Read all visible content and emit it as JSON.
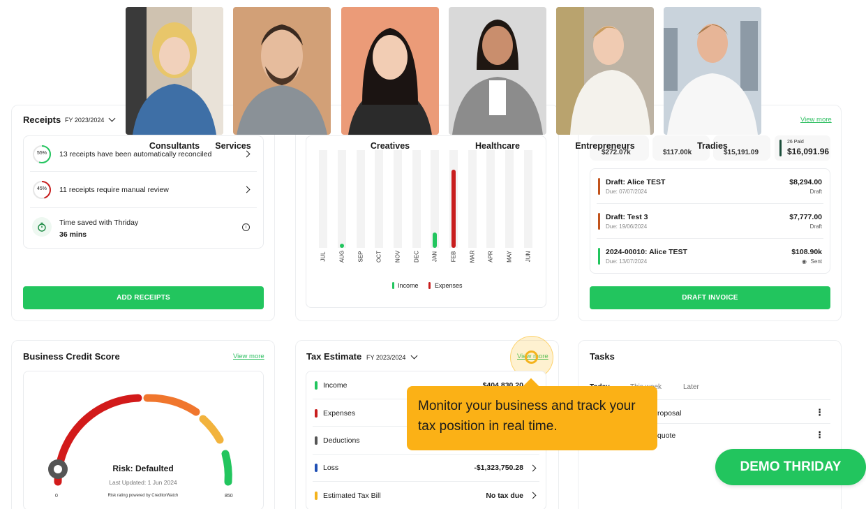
{
  "personas": [
    {
      "label": "Consultants"
    },
    {
      "label": "Services"
    },
    {
      "label": "Creatives"
    },
    {
      "label": "Healthcare"
    },
    {
      "label": "Entrepreneurs"
    },
    {
      "label": "Tradies"
    }
  ],
  "receipts": {
    "title": "Receipts",
    "fy": "FY 2023/2024",
    "rows": [
      {
        "badge": "55%",
        "text": "13 receipts have been automatically reconciled"
      },
      {
        "badge": "45%",
        "text": "11 receipts require manual review"
      }
    ],
    "time_saved_label": "Time saved with Thriday",
    "time_saved_value": "36 mins",
    "button": "ADD RECEIPTS"
  },
  "income_chart": {
    "months": [
      "JUL",
      "AUG",
      "SEP",
      "OCT",
      "NOV",
      "DEC",
      "JAN",
      "FEB",
      "MAR",
      "APR",
      "MAY",
      "JUN"
    ],
    "legend_income": "Income",
    "legend_expenses": "Expenses",
    "colors": {
      "income": "#22c55e",
      "expenses": "#c81e1e"
    }
  },
  "chart_data": {
    "type": "bar",
    "categories": [
      "JUL",
      "AUG",
      "SEP",
      "OCT",
      "NOV",
      "DEC",
      "JAN",
      "FEB",
      "MAR",
      "APR",
      "MAY",
      "JUN"
    ],
    "series": [
      {
        "name": "Income",
        "values": [
          0,
          0.04,
          0,
          0,
          0,
          0,
          0.16,
          0,
          0,
          0,
          0,
          0
        ]
      },
      {
        "name": "Expenses",
        "values": [
          0,
          0,
          0,
          0,
          0,
          0,
          0,
          0.8,
          0,
          0,
          0,
          0
        ]
      }
    ],
    "ylim": [
      0,
      1
    ]
  },
  "invoices": {
    "view_more": "View more",
    "partial_amounts": [
      "$272.07k",
      "$117.00k",
      "$15,191.09"
    ],
    "paid_label": "26 Paid",
    "paid_amount": "$16,091.96",
    "items": [
      {
        "title": "Draft: Alice TEST",
        "due": "Due: 07/07/2024",
        "amount": "$8,294.00",
        "status": "Draft",
        "color": "#c2531c"
      },
      {
        "title": "Draft: Test 3",
        "due": "Due: 19/06/2024",
        "amount": "$7,777.00",
        "status": "Draft",
        "color": "#c2531c"
      },
      {
        "title": "2024-00010: Alice TEST",
        "due": "Due: 13/07/2024",
        "amount": "$108.90k",
        "status": "Sent",
        "color": "#22c55e"
      }
    ],
    "button": "DRAFT INVOICE"
  },
  "credit": {
    "title": "Business Credit Score",
    "view_more": "View more",
    "risk": "Risk: Defaulted",
    "updated": "Last Updated: 1 Jun 2024",
    "powered": "Risk rating powered by CreditorWatch",
    "min": "0",
    "max": "850"
  },
  "tax": {
    "title": "Tax Estimate",
    "fy": "FY 2023/2024",
    "view_more": "View more",
    "rows": [
      {
        "label": "Income",
        "amount": "$404,830.20",
        "color": "#22c55e"
      },
      {
        "label": "Expenses",
        "amount": "",
        "color": "#c81e1e"
      },
      {
        "label": "Deductions",
        "amount": "",
        "color": "#555555"
      },
      {
        "label": "Loss",
        "amount": "-$1,323,750.28",
        "color": "#1f4fb4"
      },
      {
        "label": "Estimated Tax Bill",
        "amount": "No tax due",
        "color": "#f4b31c"
      }
    ]
  },
  "tasks": {
    "title": "Tasks",
    "tabs": [
      "Today",
      "This week",
      "Later"
    ],
    "items": [
      {
        "text": "roposal"
      },
      {
        "text": "quote"
      }
    ]
  },
  "tooltip": {
    "text": "Monitor your business and track your tax position in real time."
  },
  "demo_button": "DEMO THRIDAY"
}
